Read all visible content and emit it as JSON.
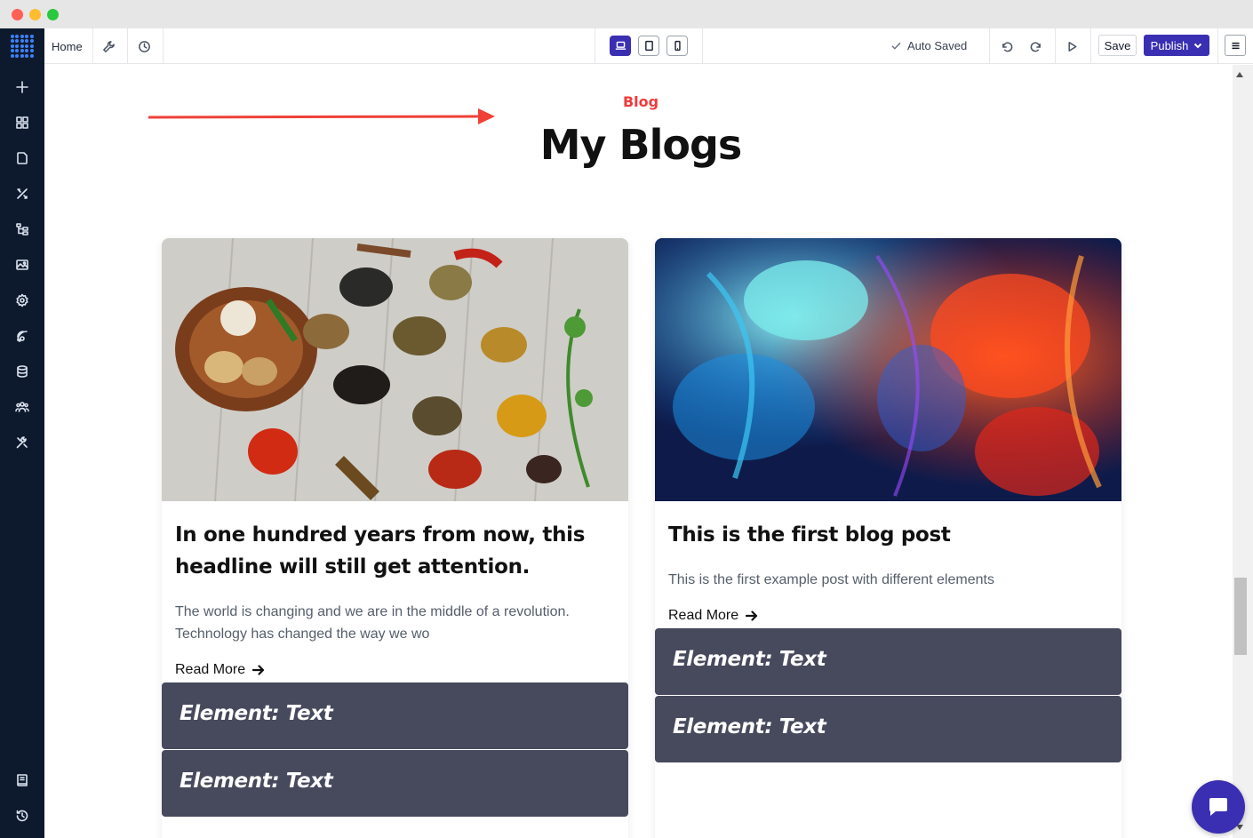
{
  "toolbar": {
    "home_label": "Home",
    "auto_saved_label": "Auto Saved",
    "save_label": "Save",
    "publish_label": "Publish"
  },
  "sidebar": {
    "items": [
      {
        "icon": "plus-icon"
      },
      {
        "icon": "widgets-icon"
      },
      {
        "icon": "page-icon"
      },
      {
        "icon": "design-tools-icon"
      },
      {
        "icon": "structure-icon"
      },
      {
        "icon": "image-icon"
      },
      {
        "icon": "settings-gear-icon"
      },
      {
        "icon": "integrations-icon"
      },
      {
        "icon": "database-icon"
      },
      {
        "icon": "users-icon"
      },
      {
        "icon": "tools-icon"
      }
    ],
    "bottom_items": [
      {
        "icon": "book-icon"
      },
      {
        "icon": "history-icon"
      }
    ]
  },
  "page": {
    "section_label": "Blog",
    "section_title": "My Blogs",
    "accent_color": "#ef3b3b",
    "posts": [
      {
        "image": "spices-photo",
        "title": "In one hundred years from now, this headline will still get attention.",
        "excerpt": "The world is changing and we are in the middle of a revolution. Technology has changed the way we wo",
        "read_more": "Read More",
        "elements": [
          "Element: Text",
          "Element: Text"
        ]
      },
      {
        "image": "colorful-ink-photo",
        "title": "This is the first blog post",
        "excerpt": "This is the first example post with different elements",
        "read_more": "Read More",
        "elements": [
          "Element: Text",
          "Element: Text"
        ]
      }
    ]
  },
  "colors": {
    "brand": "#3a2fb2",
    "sidebar_bg": "#0d1a2e",
    "element_block_bg": "#474a5d"
  }
}
